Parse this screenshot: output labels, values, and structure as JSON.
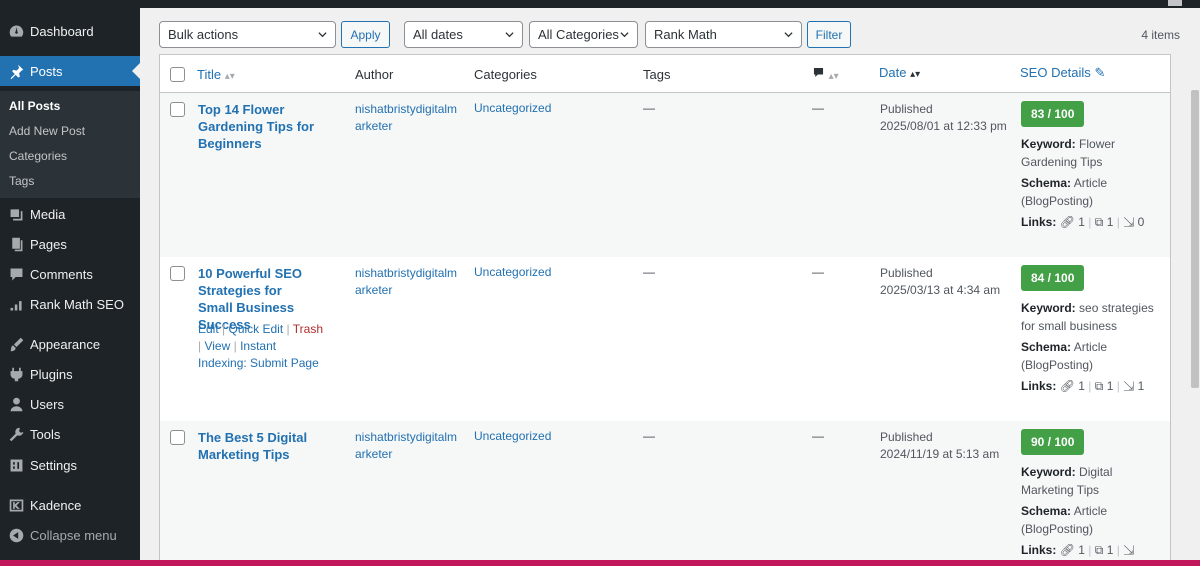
{
  "sidebar": {
    "items": [
      {
        "label": "Dashboard",
        "icon": "dashboard-icon"
      },
      {
        "label": "Posts",
        "icon": "pin-icon"
      },
      {
        "label": "Media",
        "icon": "media-icon"
      },
      {
        "label": "Pages",
        "icon": "pages-icon"
      },
      {
        "label": "Comments",
        "icon": "comment-icon"
      },
      {
        "label": "Rank Math SEO",
        "icon": "chart-icon"
      },
      {
        "label": "Appearance",
        "icon": "brush-icon"
      },
      {
        "label": "Plugins",
        "icon": "plugin-icon"
      },
      {
        "label": "Users",
        "icon": "user-icon"
      },
      {
        "label": "Tools",
        "icon": "wrench-icon"
      },
      {
        "label": "Settings",
        "icon": "settings-icon"
      },
      {
        "label": "Kadence",
        "icon": "kadence-icon"
      },
      {
        "label": "Collapse menu",
        "icon": "collapse-icon"
      }
    ],
    "submenu": [
      "All Posts",
      "Add New Post",
      "Categories",
      "Tags"
    ]
  },
  "filters": {
    "bulk_actions": "Bulk actions",
    "apply": "Apply",
    "dates": "All dates",
    "categories": "All Categories",
    "rank_math": "Rank Math",
    "filter": "Filter",
    "items_count": "4 items"
  },
  "columns": {
    "title": "Title",
    "author": "Author",
    "categories": "Categories",
    "tags": "Tags",
    "date": "Date",
    "seo": "SEO Details"
  },
  "posts": [
    {
      "title": "Top 14 Flower Gardening Tips for Beginners",
      "author": "nishatbristydigitalmarketer",
      "category": "Uncategorized",
      "tags": "—",
      "comments": "—",
      "status": "Published",
      "date": "2025/08/01 at 12:33 pm",
      "score": "83 / 100",
      "keyword": "Flower Gardening Tips",
      "schema": "Article (BlogPosting)",
      "links_internal": "1",
      "links_external": "1",
      "links_incoming": "0"
    },
    {
      "title": "10 Powerful SEO Strategies for Small Business Success",
      "author": "nishatbristydigitalmarketer",
      "category": "Uncategorized",
      "tags": "—",
      "comments": "—",
      "status": "Published",
      "date": "2025/03/13 at 4:34 am",
      "score": "84 / 100",
      "keyword": "seo strategies for small business",
      "schema": "Article (BlogPosting)",
      "links_internal": "1",
      "links_external": "1",
      "links_incoming": "1",
      "row_actions": {
        "edit": "Edit",
        "quick_edit": "Quick Edit",
        "trash": "Trash",
        "view": "View",
        "instant_indexing": "Instant Indexing: Submit Page"
      }
    },
    {
      "title": "The Best 5 Digital Marketing Tips",
      "author": "nishatbristydigitalmarketer",
      "category": "Uncategorized",
      "tags": "—",
      "comments": "—",
      "status": "Published",
      "date": "2024/11/19 at 5:13 am",
      "score": "90 / 100",
      "keyword": "Digital Marketing Tips",
      "schema": "Article (BlogPosting)",
      "links_internal": "1",
      "links_external": "1"
    }
  ],
  "labels": {
    "keyword": "Keyword:",
    "schema": "Schema:",
    "links": "Links:"
  },
  "colors": {
    "sidebar_bg": "#1d2327",
    "accent": "#2271b1",
    "score_green": "#43a047",
    "trash_red": "#b32d2e"
  }
}
